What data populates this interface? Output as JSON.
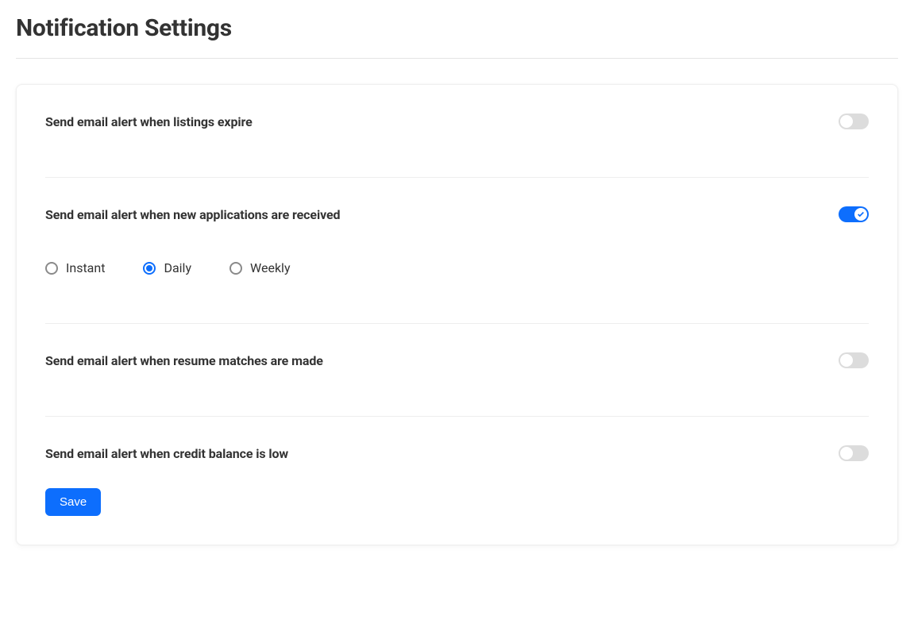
{
  "page": {
    "title": "Notification Settings"
  },
  "settings": {
    "listings_expire": {
      "label": "Send email alert when listings expire",
      "enabled": false
    },
    "new_applications": {
      "label": "Send email alert when new applications are received",
      "enabled": true,
      "frequency_selected": "daily",
      "frequency_options": {
        "instant": "Instant",
        "daily": "Daily",
        "weekly": "Weekly"
      }
    },
    "resume_matches": {
      "label": "Send email alert when resume matches are made",
      "enabled": false
    },
    "credit_balance_low": {
      "label": "Send email alert when credit balance is low",
      "enabled": false
    }
  },
  "buttons": {
    "save": "Save"
  },
  "colors": {
    "accent": "#0d6efd",
    "toggle_off": "#dcdcdc"
  }
}
